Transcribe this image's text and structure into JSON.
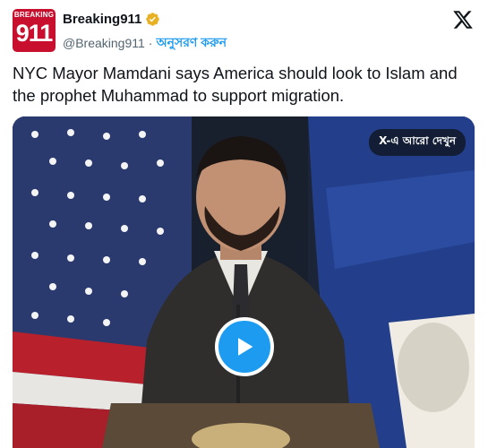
{
  "account": {
    "avatar_top": "BREAKING",
    "avatar_number": "911",
    "display_name": "Breaking911",
    "handle": "@Breaking911",
    "separator": "·",
    "follow_label": "অনুসরণ করুন",
    "verified_color": "#e8b023"
  },
  "tweet": {
    "text": "NYC Mayor Mamdani says America should look to Islam and the prophet Muhammad to support migration."
  },
  "media": {
    "see_more_label": "X-এ আরো দেখুন",
    "play_icon": "play-icon"
  },
  "colors": {
    "accent": "#1d9bf0",
    "text": "#0f1419",
    "muted": "#536471",
    "avatar_bg": "#c8102e"
  }
}
